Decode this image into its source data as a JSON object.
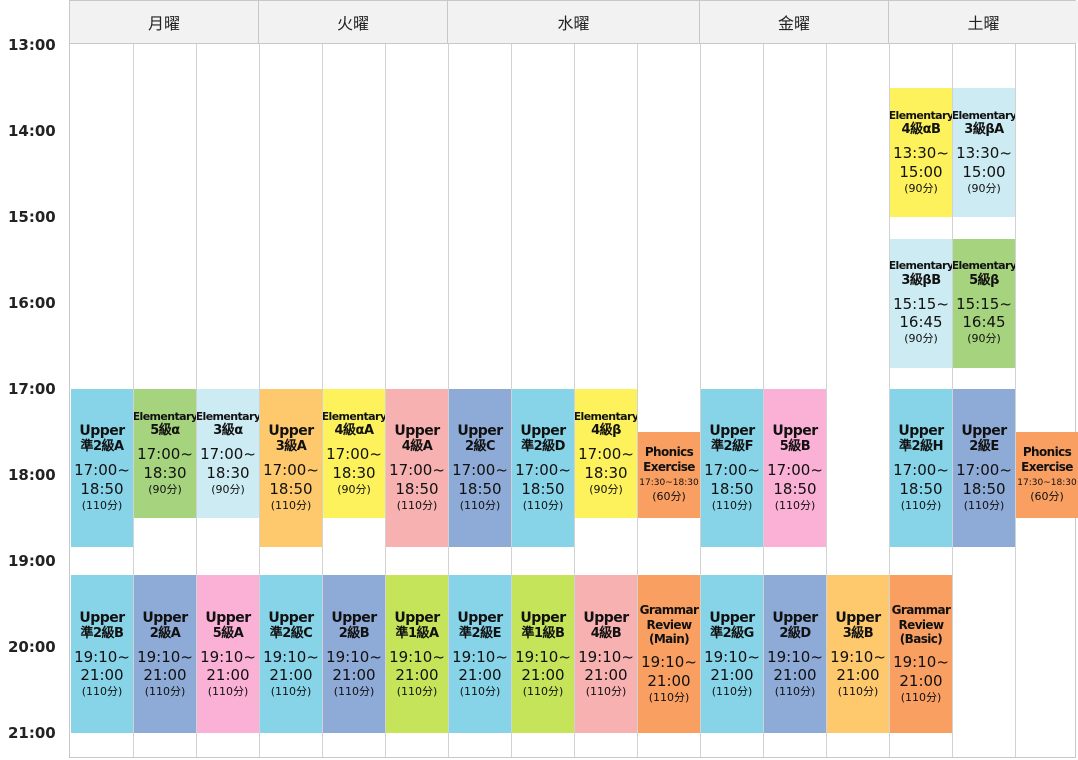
{
  "days": [
    {
      "label": "月曜",
      "cols": 3
    },
    {
      "label": "火曜",
      "cols": 3
    },
    {
      "label": "水曜",
      "cols": 4
    },
    {
      "label": "金曜",
      "cols": 3
    },
    {
      "label": "土曜",
      "cols": 3
    }
  ],
  "times": [
    "13:00",
    "14:00",
    "15:00",
    "16:00",
    "17:00",
    "18:00",
    "19:00",
    "20:00",
    "21:00"
  ],
  "colors": {
    "upper_cyan": "#87d4e8",
    "upper_blue": "#8eaad6",
    "upper_pink": "#fbb0d6",
    "upper_orange": "#fec96c",
    "upper_salmon": "#f7b1b1",
    "upper_lime": "#c6e45a",
    "elem_green": "#a6d37e",
    "elem_lightblue": "#cdebf3",
    "elem_yellow": "#fdf25b",
    "orange_course": "#f99f62"
  },
  "blocks": [
    {
      "col": 0,
      "start": "17:00",
      "end": "18:50",
      "name": "Upper",
      "level": "準2級A",
      "time1": "17:00~",
      "time2": "18:50",
      "dur": "(110分)",
      "color": "upper_cyan",
      "nameStyle": "",
      "timeStyle": ""
    },
    {
      "col": 1,
      "start": "17:00",
      "end": "18:30",
      "name": "Elementary",
      "level": "5級α",
      "time1": "17:00~",
      "time2": "18:30",
      "dur": "(90分)",
      "color": "elem_green",
      "nameStyle": "small",
      "timeStyle": ""
    },
    {
      "col": 2,
      "start": "17:00",
      "end": "18:30",
      "name": "Elementary",
      "level": "3級α",
      "time1": "17:00~",
      "time2": "18:30",
      "dur": "(90分)",
      "color": "elem_lightblue",
      "nameStyle": "small",
      "timeStyle": ""
    },
    {
      "col": 3,
      "start": "17:00",
      "end": "18:50",
      "name": "Upper",
      "level": "3級A",
      "time1": "17:00~",
      "time2": "18:50",
      "dur": "(110分)",
      "color": "upper_orange",
      "nameStyle": "",
      "timeStyle": ""
    },
    {
      "col": 4,
      "start": "17:00",
      "end": "18:30",
      "name": "Elementary",
      "level": "4級αA",
      "time1": "17:00~",
      "time2": "18:30",
      "dur": "(90分)",
      "color": "elem_yellow",
      "nameStyle": "small",
      "timeStyle": ""
    },
    {
      "col": 5,
      "start": "17:00",
      "end": "18:50",
      "name": "Upper",
      "level": "4級A",
      "time1": "17:00~",
      "time2": "18:50",
      "dur": "(110分)",
      "color": "upper_salmon",
      "nameStyle": "",
      "timeStyle": ""
    },
    {
      "col": 6,
      "start": "17:00",
      "end": "18:50",
      "name": "Upper",
      "level": "2級C",
      "time1": "17:00~",
      "time2": "18:50",
      "dur": "(110分)",
      "color": "upper_blue",
      "nameStyle": "",
      "timeStyle": ""
    },
    {
      "col": 7,
      "start": "17:00",
      "end": "18:50",
      "name": "Upper",
      "level": "準2級D",
      "time1": "17:00~",
      "time2": "18:50",
      "dur": "(110分)",
      "color": "upper_cyan",
      "nameStyle": "",
      "timeStyle": ""
    },
    {
      "col": 8,
      "start": "17:00",
      "end": "18:30",
      "name": "Elementary",
      "level": "4級β",
      "time1": "17:00~",
      "time2": "18:30",
      "dur": "(90分)",
      "color": "elem_yellow",
      "nameStyle": "small",
      "timeStyle": ""
    },
    {
      "col": 9,
      "start": "17:30",
      "end": "18:30",
      "name": "Phonics",
      "level": "Exercise",
      "time1": "17:30~18:30",
      "time2": "",
      "dur": "(60分)",
      "color": "orange_course",
      "nameStyle": "small2",
      "timeStyle": "small"
    },
    {
      "col": 10,
      "start": "17:00",
      "end": "18:50",
      "name": "Upper",
      "level": "準2級F",
      "time1": "17:00~",
      "time2": "18:50",
      "dur": "(110分)",
      "color": "upper_cyan",
      "nameStyle": "",
      "timeStyle": ""
    },
    {
      "col": 11,
      "start": "17:00",
      "end": "18:50",
      "name": "Upper",
      "level": "5級B",
      "time1": "17:00~",
      "time2": "18:50",
      "dur": "(110分)",
      "color": "upper_pink",
      "nameStyle": "",
      "timeStyle": ""
    },
    {
      "col": 13,
      "start": "13:30",
      "end": "15:00",
      "name": "Elementary",
      "level": "4級αB",
      "time1": "13:30~",
      "time2": "15:00",
      "dur": "(90分)",
      "color": "elem_yellow",
      "nameStyle": "small",
      "timeStyle": ""
    },
    {
      "col": 14,
      "start": "13:30",
      "end": "15:00",
      "name": "Elementary",
      "level": "3級βA",
      "time1": "13:30~",
      "time2": "15:00",
      "dur": "(90分)",
      "color": "elem_lightblue",
      "nameStyle": "small",
      "timeStyle": ""
    },
    {
      "col": 13,
      "start": "15:15",
      "end": "16:45",
      "name": "Elementary",
      "level": "3級βB",
      "time1": "15:15~",
      "time2": "16:45",
      "dur": "(90分)",
      "color": "elem_lightblue",
      "nameStyle": "small",
      "timeStyle": ""
    },
    {
      "col": 14,
      "start": "15:15",
      "end": "16:45",
      "name": "Elementary",
      "level": "5級β",
      "time1": "15:15~",
      "time2": "16:45",
      "dur": "(90分)",
      "color": "elem_green",
      "nameStyle": "small",
      "timeStyle": ""
    },
    {
      "col": 13,
      "start": "17:00",
      "end": "18:50",
      "name": "Upper",
      "level": "準2級H",
      "time1": "17:00~",
      "time2": "18:50",
      "dur": "(110分)",
      "color": "upper_cyan",
      "nameStyle": "",
      "timeStyle": ""
    },
    {
      "col": 14,
      "start": "17:00",
      "end": "18:50",
      "name": "Upper",
      "level": "2級E",
      "time1": "17:00~",
      "time2": "18:50",
      "dur": "(110分)",
      "color": "upper_blue",
      "nameStyle": "",
      "timeStyle": ""
    },
    {
      "col": 15,
      "start": "17:30",
      "end": "18:30",
      "name": "Phonics",
      "level": "Exercise",
      "time1": "17:30~18:30",
      "time2": "",
      "dur": "(60分)",
      "color": "orange_course",
      "nameStyle": "small2",
      "timeStyle": "small"
    },
    {
      "col": 0,
      "start": "19:10",
      "end": "21:00",
      "name": "Upper",
      "level": "準2級B",
      "time1": "19:10~",
      "time2": "21:00",
      "dur": "(110分)",
      "color": "upper_cyan",
      "nameStyle": "",
      "timeStyle": ""
    },
    {
      "col": 1,
      "start": "19:10",
      "end": "21:00",
      "name": "Upper",
      "level": "2級A",
      "time1": "19:10~",
      "time2": "21:00",
      "dur": "(110分)",
      "color": "upper_blue",
      "nameStyle": "",
      "timeStyle": ""
    },
    {
      "col": 2,
      "start": "19:10",
      "end": "21:00",
      "name": "Upper",
      "level": "5級A",
      "time1": "19:10~",
      "time2": "21:00",
      "dur": "(110分)",
      "color": "upper_pink",
      "nameStyle": "",
      "timeStyle": ""
    },
    {
      "col": 3,
      "start": "19:10",
      "end": "21:00",
      "name": "Upper",
      "level": "準2級C",
      "time1": "19:10~",
      "time2": "21:00",
      "dur": "(110分)",
      "color": "upper_cyan",
      "nameStyle": "",
      "timeStyle": ""
    },
    {
      "col": 4,
      "start": "19:10",
      "end": "21:00",
      "name": "Upper",
      "level": "2級B",
      "time1": "19:10~",
      "time2": "21:00",
      "dur": "(110分)",
      "color": "upper_blue",
      "nameStyle": "",
      "timeStyle": ""
    },
    {
      "col": 5,
      "start": "19:10",
      "end": "21:00",
      "name": "Upper",
      "level": "準1級A",
      "time1": "19:10~",
      "time2": "21:00",
      "dur": "(110分)",
      "color": "upper_lime",
      "nameStyle": "",
      "timeStyle": ""
    },
    {
      "col": 6,
      "start": "19:10",
      "end": "21:00",
      "name": "Upper",
      "level": "準2級E",
      "time1": "19:10~",
      "time2": "21:00",
      "dur": "(110分)",
      "color": "upper_cyan",
      "nameStyle": "",
      "timeStyle": ""
    },
    {
      "col": 7,
      "start": "19:10",
      "end": "21:00",
      "name": "Upper",
      "level": "準1級B",
      "time1": "19:10~",
      "time2": "21:00",
      "dur": "(110分)",
      "color": "upper_lime",
      "nameStyle": "",
      "timeStyle": ""
    },
    {
      "col": 8,
      "start": "19:10",
      "end": "21:00",
      "name": "Upper",
      "level": "4級B",
      "time1": "19:10~",
      "time2": "21:00",
      "dur": "(110分)",
      "color": "upper_salmon",
      "nameStyle": "",
      "timeStyle": ""
    },
    {
      "col": 9,
      "start": "19:10",
      "end": "21:00",
      "name": "Grammar",
      "level": "Review",
      "level2": "(Main)",
      "time1": "19:10~",
      "time2": "21:00",
      "dur": "(110分)",
      "color": "orange_course",
      "nameStyle": "small2",
      "timeStyle": ""
    },
    {
      "col": 10,
      "start": "19:10",
      "end": "21:00",
      "name": "Upper",
      "level": "準2級G",
      "time1": "19:10~",
      "time2": "21:00",
      "dur": "(110分)",
      "color": "upper_cyan",
      "nameStyle": "",
      "timeStyle": ""
    },
    {
      "col": 11,
      "start": "19:10",
      "end": "21:00",
      "name": "Upper",
      "level": "2級D",
      "time1": "19:10~",
      "time2": "21:00",
      "dur": "(110分)",
      "color": "upper_blue",
      "nameStyle": "",
      "timeStyle": ""
    },
    {
      "col": 12,
      "start": "19:10",
      "end": "21:00",
      "name": "Upper",
      "level": "3級B",
      "time1": "19:10~",
      "time2": "21:00",
      "dur": "(110分)",
      "color": "upper_orange",
      "nameStyle": "",
      "timeStyle": ""
    },
    {
      "col": 13,
      "start": "19:10",
      "end": "21:00",
      "name": "Grammar",
      "level": "Review",
      "level2": "(Basic)",
      "time1": "19:10~",
      "time2": "21:00",
      "dur": "(110分)",
      "color": "orange_course",
      "nameStyle": "small2",
      "timeStyle": ""
    }
  ]
}
